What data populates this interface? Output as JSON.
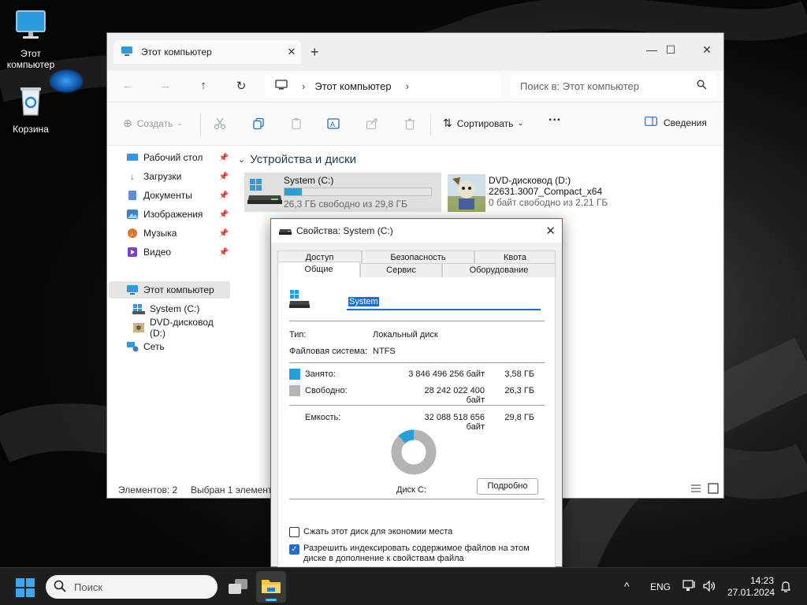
{
  "desktop": {
    "icons": [
      {
        "label_line1": "Этот",
        "label_line2": "компьютер"
      },
      {
        "label_line1": "Корзина",
        "label_line2": ""
      }
    ]
  },
  "explorer": {
    "tab_title": "Этот компьютер",
    "tab_close": "✕",
    "new_tab": "+",
    "window_controls": {
      "minimize": "—",
      "maximize": "☐",
      "close": "✕"
    },
    "address": {
      "crumb": "Этот компьютер",
      "chevron": "›"
    },
    "search_placeholder": "Поиск в: Этот компьютер",
    "toolbar": {
      "create_label": "Создать",
      "sort_label": "Сортировать",
      "more_label": "···",
      "details_label": "Сведения"
    },
    "nav": [
      {
        "label": "Рабочий стол",
        "icon": "desktop-icon",
        "pinned": true
      },
      {
        "label": "Загрузки",
        "icon": "downloads-icon",
        "pinned": true
      },
      {
        "label": "Документы",
        "icon": "documents-icon",
        "pinned": true
      },
      {
        "label": "Изображения",
        "icon": "pictures-icon",
        "pinned": true
      },
      {
        "label": "Музыка",
        "icon": "music-icon",
        "pinned": true
      },
      {
        "label": "Видео",
        "icon": "videos-icon",
        "pinned": true
      },
      {
        "label": "Этот компьютер",
        "icon": "this-pc-icon",
        "pinned": false
      },
      {
        "label": "System (C:)",
        "icon": "system-drive-icon",
        "pinned": false
      },
      {
        "label": "DVD-дисковод (D:)",
        "icon": "dvd-drive-icon",
        "pinned": false
      },
      {
        "label": "Сеть",
        "icon": "network-icon",
        "pinned": false
      }
    ],
    "group_title": "Устройства и диски",
    "drives": [
      {
        "name": "System (C:)",
        "free_text": "26,3 ГБ свободно из 29,8 ГБ",
        "used_fraction": 0.12
      },
      {
        "name": "DVD-дисковод (D:)",
        "label": "22631.3007_Compact_x64",
        "free_text": "0 байт свободно из 2,21 ГБ"
      }
    ],
    "status": {
      "items_count": "Элементов: 2",
      "selected": "Выбран 1 элемент"
    }
  },
  "dialog": {
    "title": "Свойства: System (C:)",
    "close": "✕",
    "tabs_row1": [
      "Доступ",
      "Безопасность",
      "Квота"
    ],
    "tabs_row2": [
      "Общие",
      "Сервис",
      "Оборудование"
    ],
    "active_tab": "Общие",
    "volume_name": "System",
    "type_label": "Тип:",
    "type_value": "Локальный диск",
    "fs_label": "Файловая система:",
    "fs_value": "NTFS",
    "used_label": "Занято:",
    "used_bytes": "3 846 496 256 байт",
    "used_gb": "3,58 ГБ",
    "free_label": "Свободно:",
    "free_bytes": "28 242 022 400 байт",
    "free_gb": "26,3 ГБ",
    "capacity_label": "Емкость:",
    "capacity_bytes": "32 088 518 656 байт",
    "capacity_gb": "29,8 ГБ",
    "disk_label": "Диск C:",
    "details_button": "Подробно",
    "used_fraction": 0.12,
    "used_color": "#26a0da",
    "free_color": "#b4b4b4",
    "compress_label": "Сжать этот диск для экономии места",
    "compress_checked": false,
    "index_label_line1": "Разрешить индексировать содержимое файлов на этом",
    "index_label_line2": "диске в дополнение к свойствам файла",
    "index_checked": true
  },
  "taskbar": {
    "search_placeholder": "Поиск",
    "language": "ENG",
    "time": "14:23",
    "date": "27.01.2024",
    "chevron": "^"
  }
}
